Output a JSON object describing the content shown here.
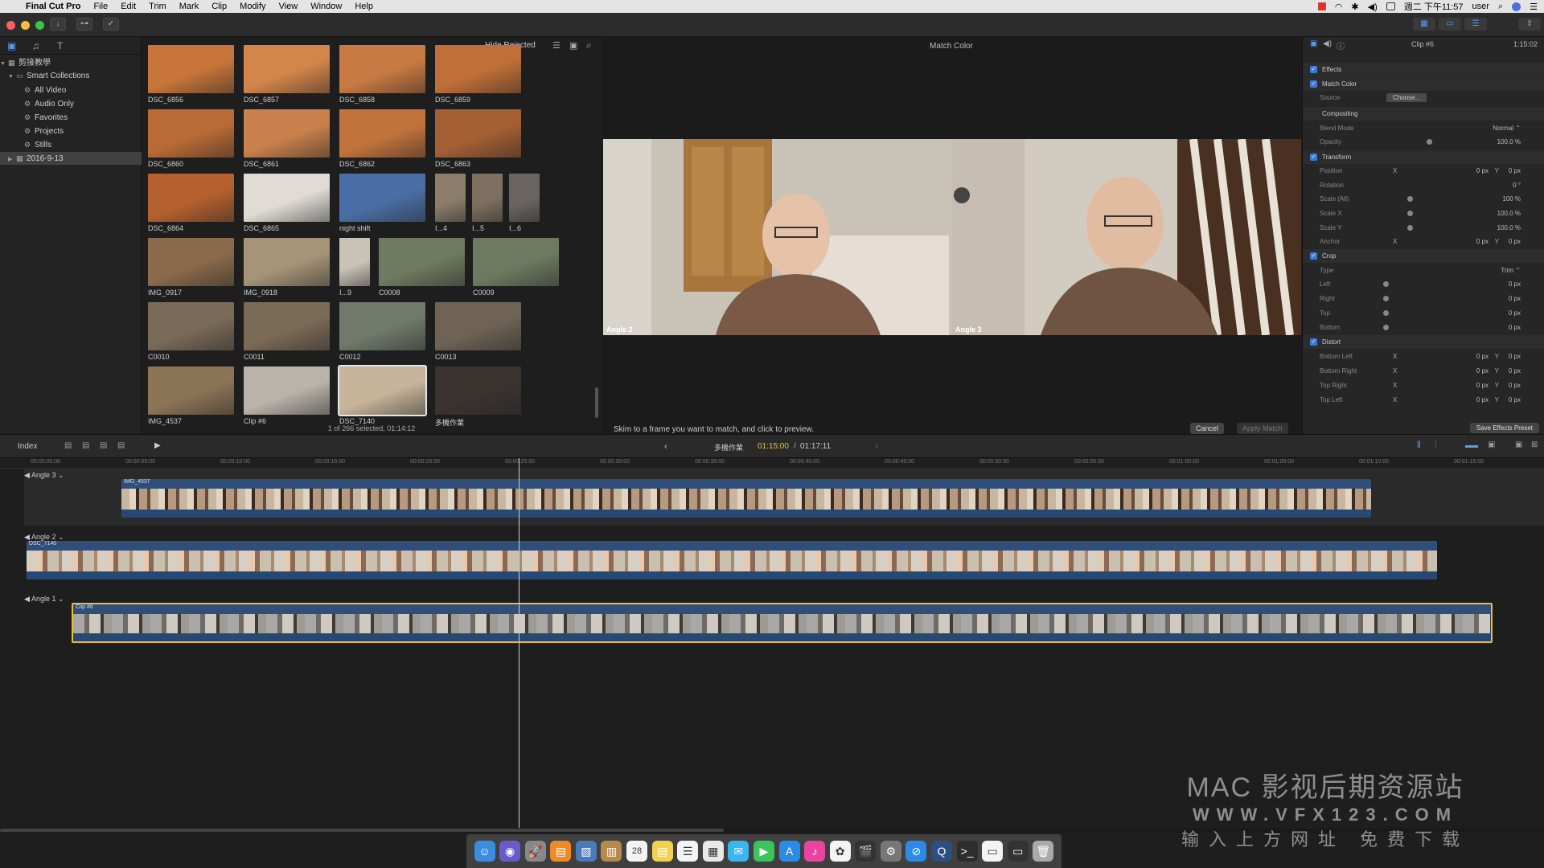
{
  "menubar": {
    "apple": "",
    "app": "Final Cut Pro",
    "items": [
      "File",
      "Edit",
      "Trim",
      "Mark",
      "Clip",
      "Modify",
      "View",
      "Window",
      "Help"
    ],
    "clock": "週二 下午11:57",
    "user": "user"
  },
  "library": {
    "name": "剪接教學",
    "items": [
      {
        "label": "Smart Collections"
      },
      {
        "label": "All Video"
      },
      {
        "label": "Audio Only"
      },
      {
        "label": "Favorites"
      },
      {
        "label": "Projects"
      },
      {
        "label": "Stills"
      },
      {
        "label": "2016-9-13"
      }
    ]
  },
  "browser": {
    "filter": "Hide Rejected",
    "status": "1 of 266 selected, 01:14:12",
    "clips": [
      {
        "name": "DSC_6856",
        "color": "#c8753a"
      },
      {
        "name": "DSC_6857",
        "color": "#d3854a"
      },
      {
        "name": "DSC_6858",
        "color": "#c97a42"
      },
      {
        "name": "DSC_6859",
        "color": "#c06f38"
      },
      {
        "name": "DSC_6860",
        "color": "#b96a35"
      },
      {
        "name": "DSC_6861",
        "color": "#c9804c"
      },
      {
        "name": "DSC_6862",
        "color": "#c2733c"
      },
      {
        "name": "DSC_6863",
        "color": "#a45f33"
      },
      {
        "name": "DSC_6864",
        "color": "#b5602f"
      },
      {
        "name": "DSC_6865",
        "color": "#e0dcd5"
      },
      {
        "name": "night shift",
        "color": "#4a6fa6"
      },
      {
        "name": "I...4",
        "color": "#8c7e6a"
      },
      {
        "name": "I...5",
        "color": "#7e6f60"
      },
      {
        "name": "I...6",
        "color": "#6a6560"
      },
      {
        "name": "IMG_0917",
        "color": "#8a6a4a"
      },
      {
        "name": "IMG_0918",
        "color": "#a69478"
      },
      {
        "name": "I...9",
        "color": "#c9c2b6"
      },
      {
        "name": "C0008",
        "color": "#6f7a5e"
      },
      {
        "name": "C0009",
        "color": "#6d7a5f"
      },
      {
        "name": "C0010",
        "color": "#7a6a58"
      },
      {
        "name": "C0011",
        "color": "#7b6a56"
      },
      {
        "name": "C0012",
        "color": "#70796a"
      },
      {
        "name": "C0013",
        "color": "#6e6354"
      },
      {
        "name": "IMG_4537",
        "color": "#8c7456"
      },
      {
        "name": "Clip #6",
        "color": "#b9b3aa"
      },
      {
        "name": "DSC_7140",
        "color": "#c7b49a"
      },
      {
        "name": "多機作業",
        "color": "#3a3330"
      }
    ]
  },
  "viewer": {
    "title": "Match Color",
    "angles": [
      {
        "label": "Angle 2"
      },
      {
        "label": "Angle 3"
      }
    ],
    "hint": "Skim to a frame you want to match, and click to preview.",
    "cancel": "Cancel",
    "apply": "Apply Match"
  },
  "inspector": {
    "clip": "Clip #6",
    "duration": "1:15:02",
    "save_preset": "Save Effects Preset",
    "rows": [
      {
        "label": "Effects",
        "hdr": true,
        "cb": true
      },
      {
        "label": "Match Color",
        "hdr": true,
        "cb": true
      },
      {
        "label": "Source",
        "btn": "Choose..."
      },
      {
        "label": "Compositing",
        "hdr": true
      },
      {
        "label": "Blend Mode",
        "v3": "Normal ⌃"
      },
      {
        "label": "Opacity",
        "v3": "100.0  %",
        "slider": 0.9
      },
      {
        "label": "Transform",
        "hdr": true,
        "cb": true
      },
      {
        "label": "Position",
        "v1": "X",
        "v2": "0  px",
        "v3": "0  px",
        "y": "Y"
      },
      {
        "label": "Rotation",
        "v3": "0  °"
      },
      {
        "label": "Scale (All)",
        "v3": "100  %",
        "slider": 0.5
      },
      {
        "label": "Scale X",
        "v3": "100.0  %",
        "slider": 0.5
      },
      {
        "label": "Scale Y",
        "v3": "100.0  %",
        "slider": 0.5
      },
      {
        "label": "Anchor",
        "v1": "X",
        "v2": "0  px",
        "v3": "0  px",
        "y": "Y"
      },
      {
        "label": "Crop",
        "hdr": true,
        "cb": true
      },
      {
        "label": "Type",
        "v3": "Trim ⌃"
      },
      {
        "label": "Left",
        "v3": "0  px",
        "slider": 0
      },
      {
        "label": "Right",
        "v3": "0  px",
        "slider": 0
      },
      {
        "label": "Top",
        "v3": "0  px",
        "slider": 0
      },
      {
        "label": "Bottom",
        "v3": "0  px",
        "slider": 0
      },
      {
        "label": "Distort",
        "hdr": true,
        "cb": true
      },
      {
        "label": "Bottom Left",
        "v1": "X",
        "v2": "0  px",
        "v3": "0  px",
        "y": "Y"
      },
      {
        "label": "Bottom Right",
        "v1": "X",
        "v2": "0  px",
        "v3": "0  px",
        "y": "Y"
      },
      {
        "label": "Top Right",
        "v1": "X",
        "v2": "0  px",
        "v3": "0  px",
        "y": "Y"
      },
      {
        "label": "Top Left",
        "v1": "X",
        "v2": "0  px",
        "v3": "0  px",
        "y": "Y"
      }
    ]
  },
  "timeline": {
    "index": "Index",
    "project": "多機作業",
    "timecode": "01:15:00",
    "duration": "01:17:11",
    "ruler": [
      "00:00:00:00",
      "00:00:05:00",
      "00:00:10:00",
      "00:00:15:00",
      "00:00:20:00",
      "00:00:25:00",
      "00:00:30:00",
      "00:00:35:00",
      "00:00:40:00",
      "00:00:45:00",
      "00:00:50:00",
      "00:00:55:00",
      "00:01:00:00",
      "00:01:05:00",
      "00:01:10:00",
      "00:01:15:00"
    ],
    "lanes": [
      {
        "label": "Angle 3",
        "clip": "IMG_4537"
      },
      {
        "label": "Angle 2",
        "clip": "DSC_7140"
      },
      {
        "label": "Angle 1",
        "clip": "Clip #6"
      }
    ]
  },
  "dock": {
    "icons": [
      "finder-icon",
      "siri-icon",
      "launchpad-icon",
      "ibooks-icon",
      "preview-icon",
      "contacts-icon",
      "calendar-icon",
      "notes-icon",
      "reminders-icon",
      "photos-icon",
      "messages-icon",
      "facetime-icon",
      "appstore-icon",
      "itunes-icon",
      "photos2-icon",
      "finalcut-icon",
      "systemprefs-icon",
      "safari-icon",
      "quicktime-icon",
      "terminal-icon",
      "docs-icon",
      "display-icon",
      "trash-icon"
    ],
    "calendar_day": "28"
  },
  "watermark": {
    "line1": "MAC 影视后期资源站",
    "line2": "WWW.VFX123.COM",
    "line3": "输入上方网址 免费下载"
  }
}
